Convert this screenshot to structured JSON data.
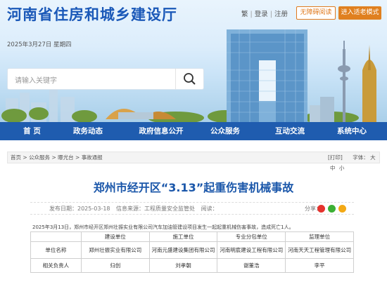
{
  "header": {
    "site_title": "河南省住房和城乡建设厅",
    "lang_trad": "繁",
    "sep1": "|",
    "login": "登录",
    "sep2": "|",
    "register": "注册",
    "accessible_btn": "无障碍阅读",
    "elder_btn": "进入适老模式",
    "date": "2025年3月27日 星期四",
    "search_placeholder": "请输入关键字"
  },
  "nav": {
    "items": [
      "首 页",
      "政务动态",
      "政府信息公开",
      "公众服务",
      "互动交流",
      "系统中心"
    ]
  },
  "breadcrumb": {
    "path": [
      "首页",
      "公众服务",
      "曝光台",
      "事故通报"
    ],
    "separator": " > ",
    "print": "[打印]",
    "font_label": "字体：",
    "font_large": "大",
    "font_medium": "中",
    "font_small": "小"
  },
  "article": {
    "title": "郑州市经开区“3.13”起重伤害机械事故",
    "publish_label": "发布日期：",
    "publish_date": "2025-03-18",
    "source_label": "信息来源：",
    "source": "工程质量安全监管处",
    "read_label": "阅读：",
    "share_label": "分享：",
    "paragraph": "2025年3月13日，郑州市经开区郑州壮振实业有限公司汽车加油管建设项目发生一起起重机械伤害事故，造成死亡1人。"
  },
  "table": {
    "headers": [
      "",
      "建设单位",
      "施工单位",
      "专业分包单位",
      "监理单位"
    ],
    "rows": [
      [
        "单位名称",
        "郑州壮振实业有限公司",
        "河南元盛建设集团有限公司",
        "河南明宸建设工程有限公司",
        "河南天天工程管理有限公司"
      ],
      [
        "相关负责人",
        "归创",
        "刘孝朝",
        "谢董浩",
        "李平"
      ]
    ]
  },
  "colors": {
    "brand_blue": "#1a58b8",
    "nav_blue": "#1f5caf",
    "orange": "#e0801f"
  }
}
